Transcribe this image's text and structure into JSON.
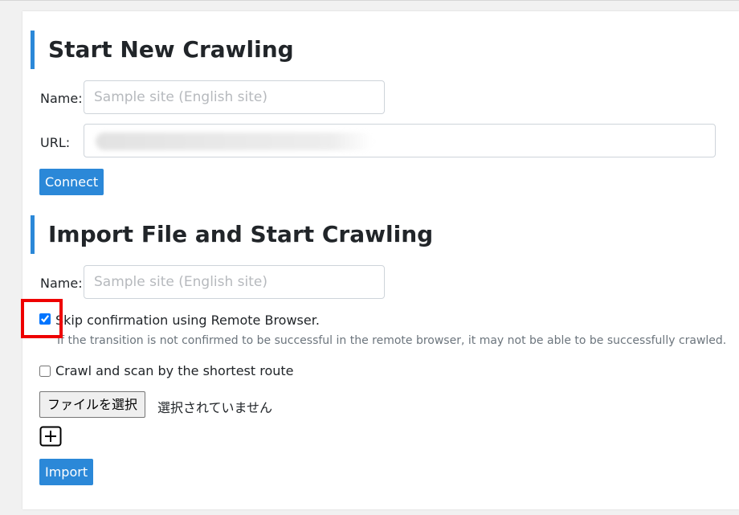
{
  "section1": {
    "title": "Start New Crawling",
    "name_label": "Name:",
    "name_placeholder": "Sample site (English site)",
    "url_label": "URL:",
    "connect_button": "Connect"
  },
  "section2": {
    "title": "Import File and Start Crawling",
    "name_label": "Name:",
    "name_placeholder": "Sample site (English site)",
    "skip_confirmation": {
      "label": "Skip confirmation using Remote Browser.",
      "checked": true,
      "help": "If the transition is not confirmed to be successful in the remote browser, it may not be able to be successfully crawled."
    },
    "shortest_route": {
      "label": "Crawl and scan by the shortest route",
      "checked": false
    },
    "file_button": "ファイルを選択",
    "file_status": "選択されていません",
    "add_icon": "plus-square-icon",
    "import_button": "Import"
  },
  "colors": {
    "accent": "#2b88d8",
    "highlight": "#ee0000"
  }
}
